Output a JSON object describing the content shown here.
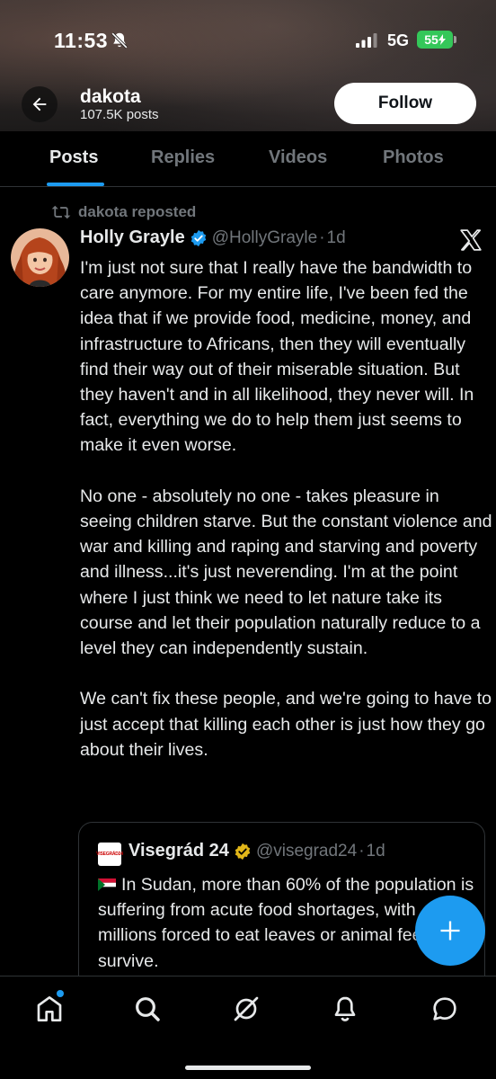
{
  "status_bar": {
    "time": "11:53",
    "network": "5G",
    "battery": "55"
  },
  "profile": {
    "name": "dakota",
    "post_count": "107.5K posts",
    "follow_label": "Follow"
  },
  "tabs": [
    {
      "label": "Posts",
      "active": true
    },
    {
      "label": "Replies",
      "active": false
    },
    {
      "label": "Videos",
      "active": false
    },
    {
      "label": "Photos",
      "active": false
    }
  ],
  "post": {
    "repost_label": "dakota reposted",
    "author_name": "Holly Grayle",
    "handle": "@HollyGrayle",
    "separator": "·",
    "age": "1d",
    "text": "I'm just not sure that I really have the bandwidth to care anymore. For my entire life, I've been fed the idea that if we provide food, medicine, money, and infrastructure to Africans, then they will eventually find their way out of their miserable situation. But they haven't and in all likelihood, they never will. In fact, everything we do to help them just seems to make it even worse.\n\nNo one - absolutely no one - takes pleasure in seeing children starve. But the constant violence and war and killing and raping and starving and poverty and illness...it's just neverending. I'm at the point where I just think we need to let nature take its course and let their population naturally reduce to a level they can independently sustain.\n\nWe can't fix these people, and we're going to have to just accept that killing each other is just how they go about their lives."
  },
  "quoted_post": {
    "logo_text": "VISEGRÁD24",
    "author_name": "Visegrád 24",
    "handle": "@visegrad24",
    "separator": "·",
    "age": "1d",
    "text": "In Sudan, more than 60% of the population is suffering from acute food shortages, with millions forced to eat leaves or animal feed to survive."
  },
  "colors": {
    "accent": "#1d9bf0",
    "verified_gold": "#e2b719",
    "battery": "#34c759",
    "text_primary": "#e7e9ea",
    "text_secondary": "#71767b",
    "divider": "#2f3336"
  },
  "icons": {
    "back": "arrow-left-icon",
    "repost": "repost-icon",
    "verified": "verified-badge-icon",
    "x_logo": "x-logo-icon",
    "compose": "plus-icon",
    "nav": [
      "home-icon",
      "search-icon",
      "grok-icon",
      "notifications-icon",
      "messages-icon"
    ]
  }
}
